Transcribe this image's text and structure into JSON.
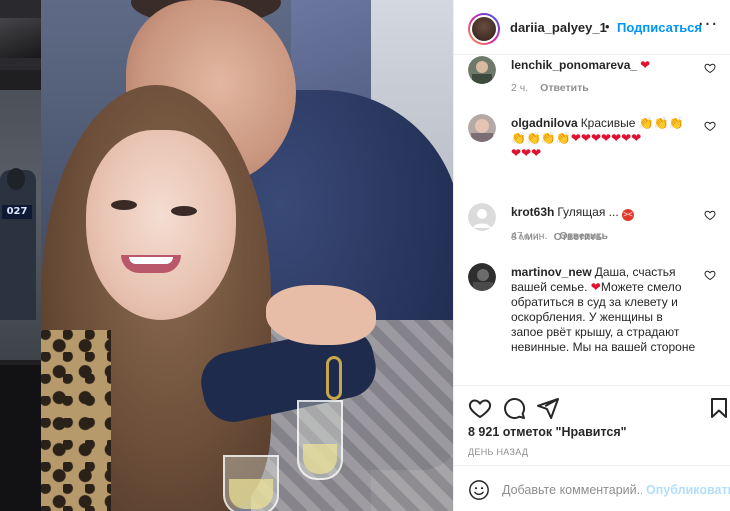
{
  "header": {
    "username": "dariia_palyey_1",
    "separator": "•",
    "follow_label": "Подписаться",
    "more_icon": "more-horizontal-icon"
  },
  "comments": [
    {
      "username": "lenchik_ponomareva_",
      "text": "",
      "emoji": [
        "red-heart"
      ],
      "time": "2 ч.",
      "reply_label": "Ответить"
    },
    {
      "username": "olgadnilova",
      "text": "Красивые",
      "emoji": [
        "clap",
        "clap",
        "clap",
        "clap",
        "clap",
        "clap",
        "clap",
        "red-heart",
        "red-heart",
        "red-heart",
        "red-heart",
        "red-heart",
        "red-heart",
        "red-heart",
        "red-heart",
        "red-heart",
        "red-heart"
      ],
      "time": "47 мин.",
      "reply_label": "Ответить"
    },
    {
      "username": "krot63h",
      "text": "Гулящая ...",
      "emoji": [
        "angry-face"
      ],
      "time": "8 мин.",
      "reply_label": "Ответить"
    },
    {
      "username": "martinov_new",
      "text_part1": "Даша, счастья вашей семье.",
      "text_part2": "Можете смело обратиться в суд за клевету и оскорбления. У женщины в запое рвёт крышу, а страдают невинные. Мы на вашей стороне",
      "emoji": [
        "red-heart"
      ]
    }
  ],
  "actions": {
    "like_icon": "heart-outline-icon",
    "comment_icon": "comment-bubble-icon",
    "share_icon": "paper-plane-icon",
    "save_icon": "bookmark-icon",
    "likes_text": "8 921 отметок \"Нравится\"",
    "date_text": "ДЕНЬ НАЗАД"
  },
  "add_comment": {
    "emoji_icon": "smiley-icon",
    "placeholder": "Добавьте комментарий...",
    "post_label": "Опубликовать"
  },
  "colors": {
    "accent": "#0095f6",
    "post_disabled": "#b2dffc",
    "muted": "#8e8e8e",
    "heart": "#e0102e"
  },
  "backdrop": {
    "badge_text": "027"
  }
}
